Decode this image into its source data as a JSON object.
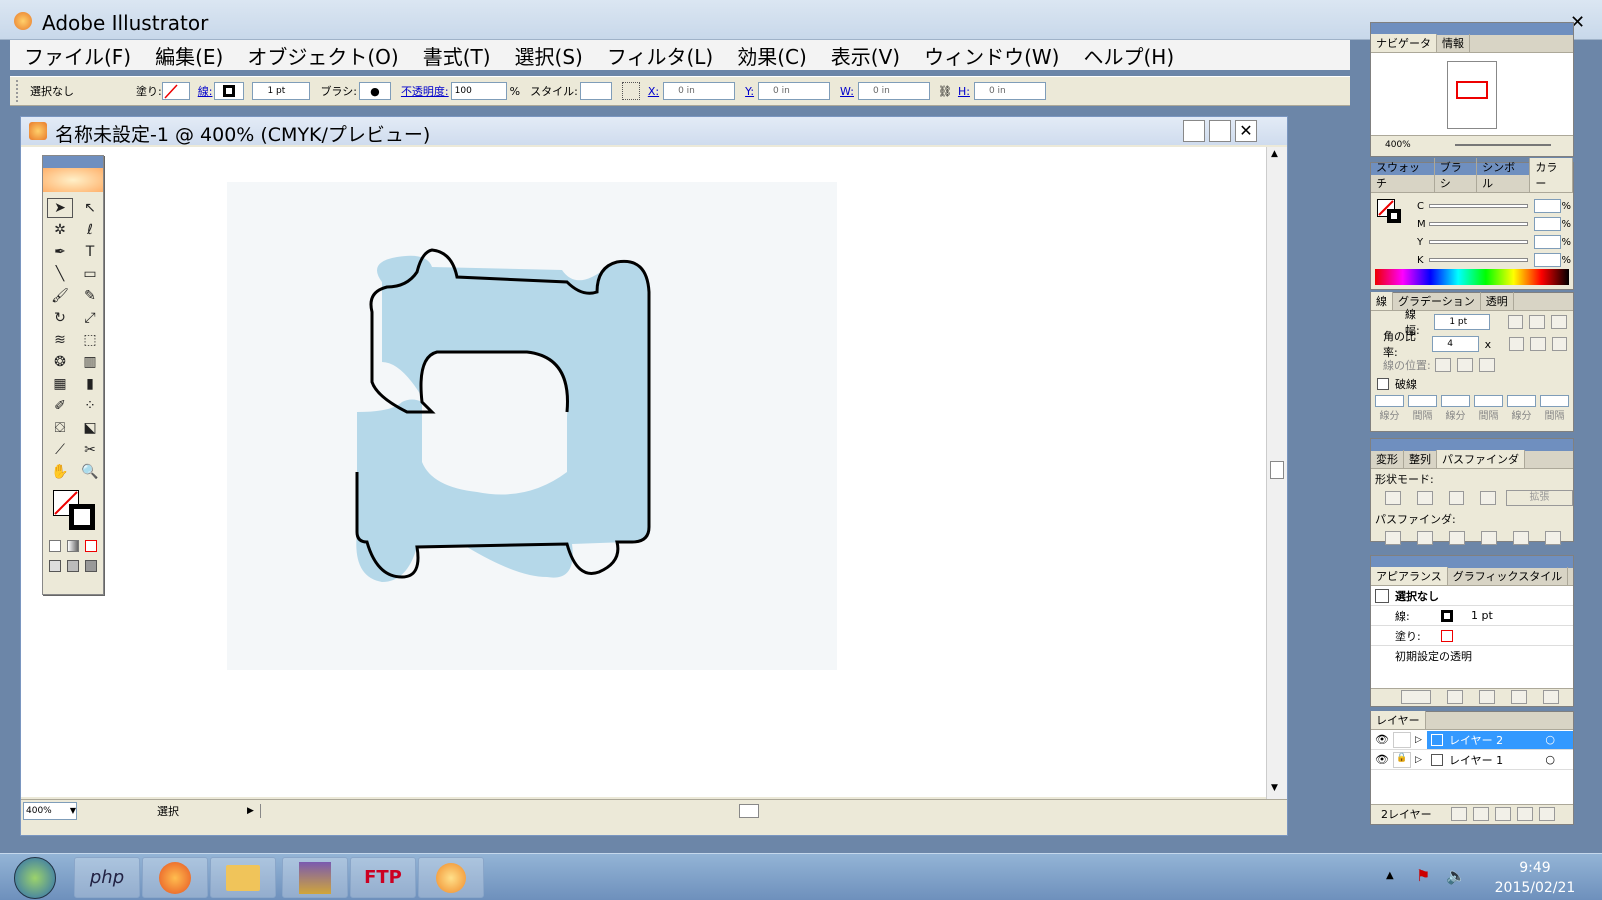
{
  "app": {
    "title": "Adobe Illustrator"
  },
  "menu": [
    "ファイル(F)",
    "編集(E)",
    "オブジェクト(O)",
    "書式(T)",
    "選択(S)",
    "フィルタ(L)",
    "効果(C)",
    "表示(V)",
    "ウィンドウ(W)",
    "ヘルプ(H)"
  ],
  "control": {
    "selection": "選択なし",
    "fill_label": "塗り:",
    "stroke_label": "線:",
    "stroke_weight": "1 pt",
    "brush_label": "ブラシ:",
    "opacity_label": "不透明度:",
    "opacity_value": "100",
    "percent": "%",
    "style_label": "スタイル:",
    "x_label": "X:",
    "x_value": "0 in",
    "y_label": "Y:",
    "y_value": "0 in",
    "w_label": "W:",
    "w_value": "0 in",
    "h_label": "H:",
    "h_value": "0 in"
  },
  "document": {
    "title": "名称未設定-1 @ 400% (CMYK/プレビュー)",
    "zoom": "400%",
    "status": "選択"
  },
  "panels": {
    "navigator": {
      "tabs": [
        "ナビゲータ",
        "情報"
      ],
      "zoom": "400%"
    },
    "color": {
      "tabs": [
        "スウォッチ",
        "ブラシ",
        "シンボル",
        "カラー"
      ],
      "channels": [
        "C",
        "M",
        "Y",
        "K"
      ],
      "percent": "%"
    },
    "stroke": {
      "tabs": [
        "線",
        "グラデーション",
        "透明"
      ],
      "weight_label": "線幅:",
      "weight_value": "1 pt",
      "miter_label": "角の比率:",
      "miter_value": "4",
      "miter_unit": "x",
      "align_label": "線の位置:",
      "dashed_label": "破線",
      "dash_labels": [
        "線分",
        "間隔",
        "線分",
        "間隔",
        "線分",
        "間隔"
      ]
    },
    "pathfinder": {
      "tabs": [
        "変形",
        "整列",
        "パスファインダ"
      ],
      "shape_modes": "形状モード:",
      "expand": "拡張",
      "pathfinders": "パスファインダ:"
    },
    "appearance": {
      "tabs": [
        "アピアランス",
        "グラフィックスタイル"
      ],
      "title": "選択なし",
      "stroke_label": "線:",
      "stroke_value": "1 pt",
      "fill_label": "塗り:",
      "opacity": "初期設定の透明"
    },
    "layers": {
      "tab": "レイヤー",
      "items": [
        "レイヤー 2",
        "レイヤー 1"
      ],
      "count": "2レイヤー"
    }
  },
  "taskbar": {
    "apps": [
      "php",
      "firefox",
      "folder",
      "winrar",
      "ftp",
      "illustrator"
    ],
    "time": "9:49",
    "date": "2015/02/21"
  },
  "colors": {
    "selection": "#3399ff",
    "shape_fill": "#a9d2e6",
    "title_blue": "#6f8fbf"
  }
}
